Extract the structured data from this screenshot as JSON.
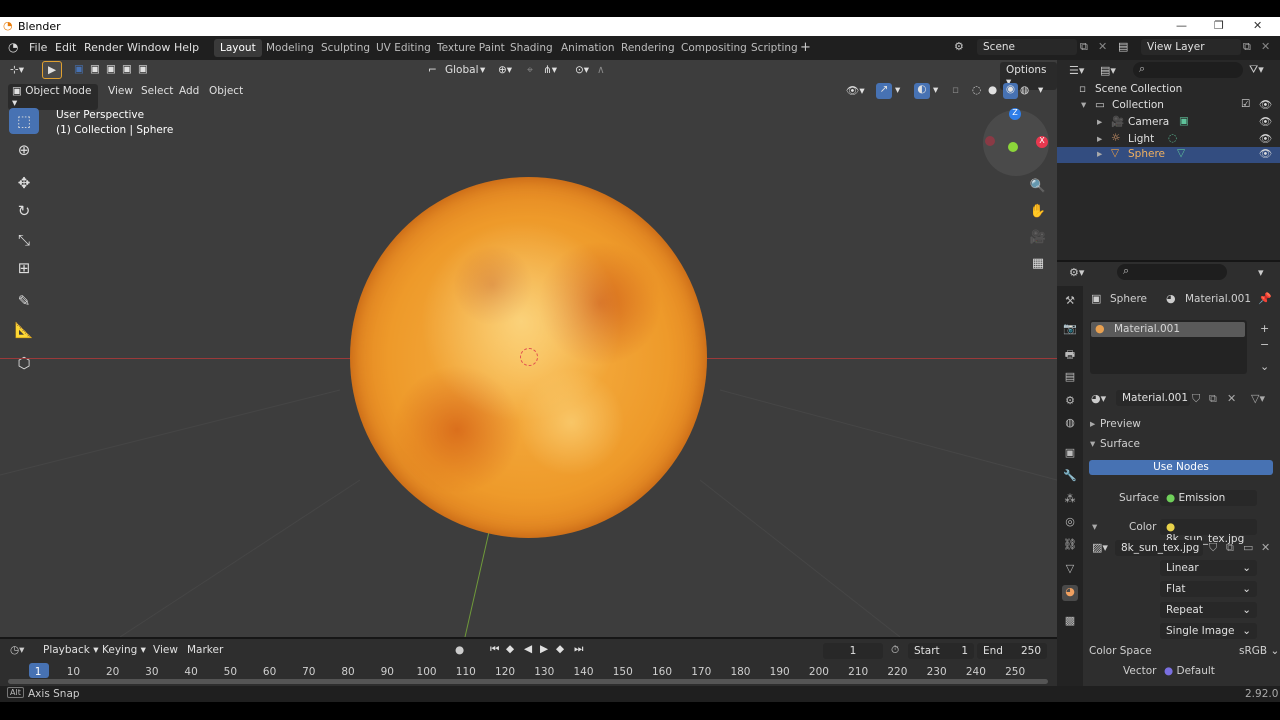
{
  "window_title": "Blender",
  "menu": [
    "File",
    "Edit",
    "Render",
    "Window",
    "Help"
  ],
  "workspaces": [
    "Layout",
    "Modeling",
    "Sculpting",
    "UV Editing",
    "Texture Paint",
    "Shading",
    "Animation",
    "Rendering",
    "Compositing",
    "Scripting"
  ],
  "active_workspace": "Layout",
  "scene": "Scene",
  "view_layer": "View Layer",
  "viewport": {
    "transform_orientation": "Global",
    "options_label": "Options",
    "mode": "Object Mode",
    "header_menu": [
      "View",
      "Select",
      "Add",
      "Object"
    ],
    "overlay_line1": "User Perspective",
    "overlay_line2": "(1) Collection | Sphere"
  },
  "outliner": {
    "root": "Scene Collection",
    "collection": "Collection",
    "items": [
      "Camera",
      "Light",
      "Sphere"
    ],
    "selected": "Sphere"
  },
  "properties": {
    "object_name": "Sphere",
    "material_name": "Material.001",
    "slot": "Material.001",
    "material_field": "Material.001",
    "panel_preview": "Preview",
    "panel_surface": "Surface",
    "use_nodes": "Use Nodes",
    "surface_label": "Surface",
    "surface_value": "Emission",
    "color_label": "Color",
    "color_value": "8k_sun_tex.jpg",
    "image_name": "8k_sun_tex.jpg",
    "interpolation": "Linear",
    "projection": "Flat",
    "extension": "Repeat",
    "source": "Single Image",
    "color_space_label": "Color Space",
    "color_space": "sRGB",
    "vector_label": "Vector",
    "vector_value": "Default"
  },
  "timeline": {
    "menu": [
      "Playback",
      "Keying",
      "View",
      "Marker"
    ],
    "current_frame": "1",
    "start_label": "Start",
    "start": "1",
    "end_label": "End",
    "end": "250",
    "ticks": [
      "1",
      "10",
      "20",
      "30",
      "40",
      "50",
      "60",
      "70",
      "80",
      "90",
      "100",
      "110",
      "120",
      "130",
      "140",
      "150",
      "160",
      "170",
      "180",
      "190",
      "200",
      "210",
      "220",
      "230",
      "240",
      "250"
    ]
  },
  "status": {
    "key_hint": "Alt",
    "hint": "Axis Snap",
    "version": "2.92.0"
  },
  "colors": {
    "accent_blue": "#4772b3",
    "selected_row": "#334d80",
    "sun_orange": "#ee9a2a"
  }
}
